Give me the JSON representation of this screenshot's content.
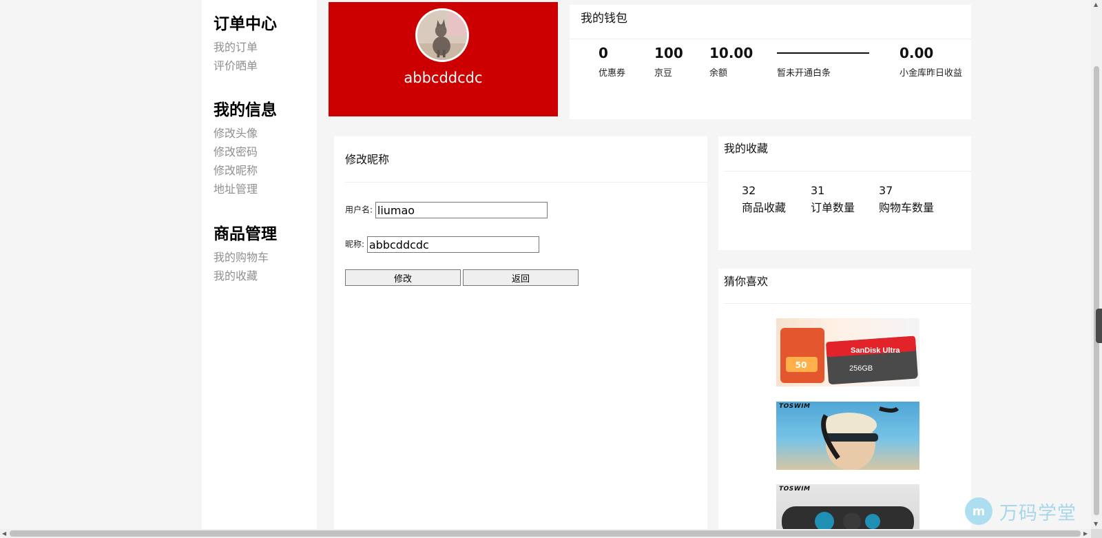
{
  "sidebar": {
    "groups": [
      {
        "title": "订单中心",
        "items": [
          "我的订单",
          "评价晒单"
        ]
      },
      {
        "title": "我的信息",
        "items": [
          "修改头像",
          "修改密码",
          "修改昵称",
          "地址管理"
        ]
      },
      {
        "title": "商品管理",
        "items": [
          "我的购物车",
          "我的收藏"
        ]
      }
    ]
  },
  "profile": {
    "nickname": "abbcddcdc"
  },
  "wallet": {
    "title": "我的钱包",
    "stats": [
      {
        "value": "0",
        "label": "优惠券"
      },
      {
        "value": "100",
        "label": "京豆"
      },
      {
        "value": "10.00",
        "label": "余额"
      },
      {
        "value": "",
        "label": "暂未开通白条"
      },
      {
        "value": "0.00",
        "label": "小金库昨日收益"
      }
    ]
  },
  "edit": {
    "title": "修改昵称",
    "username_label": "用户名:",
    "username_value": "liumao",
    "nickname_label": "昵称:",
    "nickname_value": "abbcddcdc",
    "submit_label": "修改",
    "back_label": "返回"
  },
  "favorites": {
    "title": "我的收藏",
    "stats": [
      {
        "value": "32",
        "label": "商品收藏"
      },
      {
        "value": "31",
        "label": "订单数量"
      },
      {
        "value": "37",
        "label": "购物车数量"
      }
    ]
  },
  "recommend": {
    "title": "猜你喜欢",
    "products": [
      {
        "brand": "SanDisk Ultra",
        "capacity": "256GB",
        "badge": "50"
      },
      {
        "brand": "TOSWIM"
      },
      {
        "brand": "TOSWIM"
      }
    ]
  },
  "watermark": {
    "text": "万码学堂"
  },
  "colors": {
    "profile_bg": "#cc0000",
    "page_bg": "#f5f5f5",
    "muted_text": "#8f8f8f"
  }
}
